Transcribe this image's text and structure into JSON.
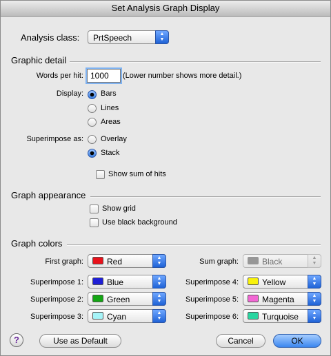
{
  "window": {
    "title": "Set Analysis Graph Display"
  },
  "analysis_class": {
    "label": "Analysis class:",
    "value": "PrtSpeech"
  },
  "graphic_detail": {
    "heading": "Graphic detail",
    "words_per_hit_label": "Words per hit:",
    "words_per_hit_value": "1000",
    "words_per_hit_hint": "(Lower number shows more detail.)",
    "display_label": "Display:",
    "display_options": [
      "Bars",
      "Lines",
      "Areas"
    ],
    "display_selected": "Bars",
    "superimpose_label": "Superimpose as:",
    "superimpose_options": [
      "Overlay",
      "Stack"
    ],
    "superimpose_selected": "Stack",
    "show_sum_label": "Show sum of hits",
    "show_sum_checked": false
  },
  "graph_appearance": {
    "heading": "Graph appearance",
    "show_grid_label": "Show grid",
    "show_grid_checked": false,
    "black_bg_label": "Use black background",
    "black_bg_checked": false
  },
  "graph_colors": {
    "heading": "Graph colors",
    "first": {
      "label": "First graph:",
      "value": "Red",
      "color": "#e8121b"
    },
    "sum": {
      "label": "Sum graph:",
      "value": "Black",
      "color": "#555555"
    },
    "s1": {
      "label": "Superimpose 1:",
      "value": "Blue",
      "color": "#1f1fd6"
    },
    "s2": {
      "label": "Superimpose 2:",
      "value": "Green",
      "color": "#14a614"
    },
    "s3": {
      "label": "Superimpose 3:",
      "value": "Cyan",
      "color": "#a6f4f8"
    },
    "s4": {
      "label": "Superimpose 4:",
      "value": "Yellow",
      "color": "#f8f20c"
    },
    "s5": {
      "label": "Superimpose 5:",
      "value": "Magenta",
      "color": "#f267d4"
    },
    "s6": {
      "label": "Superimpose 6:",
      "value": "Turquoise",
      "color": "#2ad6a1"
    }
  },
  "buttons": {
    "help": "?",
    "use_default": "Use as Default",
    "cancel": "Cancel",
    "ok": "OK"
  },
  "icons": {
    "help": "help-icon",
    "popup_arrows": "updown-arrows-icon"
  }
}
